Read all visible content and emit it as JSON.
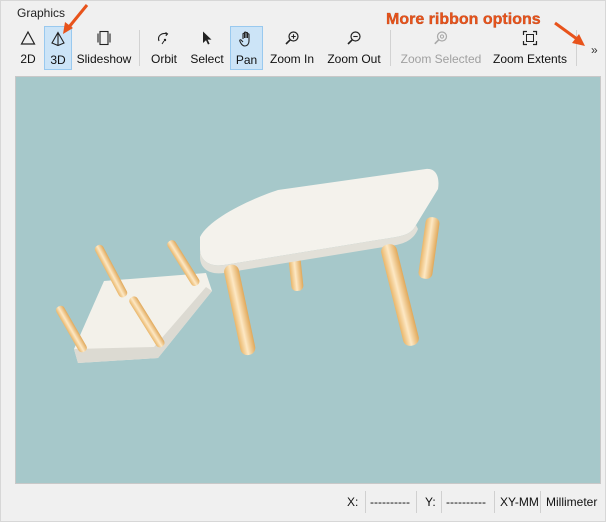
{
  "group": {
    "title": "Graphics"
  },
  "toolbar": {
    "buttons": [
      {
        "label": "2D",
        "icon": "triangle-2d-icon"
      },
      {
        "label": "3D",
        "icon": "pyramid-3d-icon",
        "active": true
      },
      {
        "label": "Slideshow",
        "icon": "slideshow-icon"
      },
      {
        "label": "Orbit",
        "icon": "orbit-icon"
      },
      {
        "label": "Select",
        "icon": "cursor-arrow-icon"
      },
      {
        "label": "Pan",
        "icon": "hand-pan-icon",
        "active": true
      },
      {
        "label": "Zoom In",
        "icon": "zoom-in-icon"
      },
      {
        "label": "Zoom Out",
        "icon": "zoom-out-icon"
      },
      {
        "label": "Zoom Selected",
        "icon": "zoom-selected-icon",
        "disabled": true
      },
      {
        "label": "Zoom Extents",
        "icon": "zoom-extents-icon"
      }
    ],
    "overflow_label": "»"
  },
  "annotation": {
    "text": "More ribbon options",
    "color": "#e8531b"
  },
  "viewport": {
    "background": "#a6c8ca"
  },
  "status": {
    "x_label": "X:",
    "x_value": "----------",
    "y_label": "Y:",
    "y_value": "----------",
    "plane": "XY-MM",
    "units": "Millimeter"
  }
}
